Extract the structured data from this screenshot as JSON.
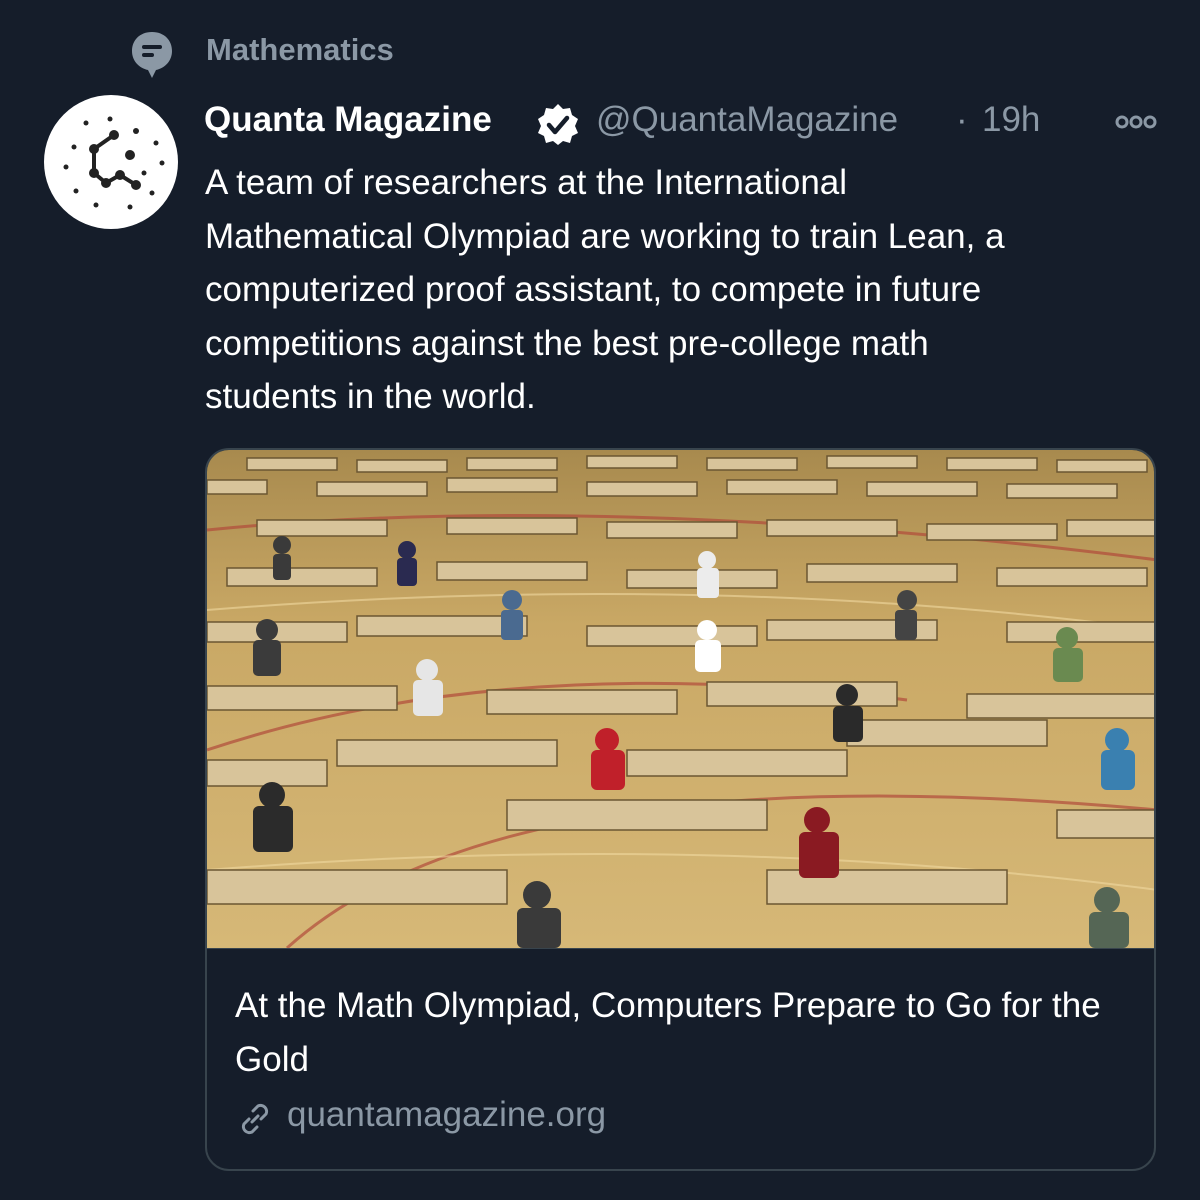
{
  "topic": {
    "label": "Mathematics",
    "icon": "topic-speech-bubble-icon"
  },
  "tweet": {
    "author_name": "Quanta Magazine",
    "verified": true,
    "handle": "@QuantaMagazine",
    "separator": "·",
    "time": "19h",
    "text": "A team of researchers at the International\nMathematical Olympiad are working to train Lean, a\ncomputerized proof assistant, to compete in future\ncompetitions against the best pre-college math\nstudents in the world."
  },
  "card": {
    "title": "At the Math Olympiad, Computers Prepare to Go for the Gold",
    "domain": "quantamagazine.org",
    "image_alt": "Students sitting at rows of exam desks in a large gymnasium"
  },
  "colors": {
    "background": "#151d2a",
    "primary_text": "#ffffff",
    "secondary_text": "#8b98a5",
    "border": "#38444d",
    "gym_floor": "#c9a865"
  },
  "icons": [
    "topic-speech-bubble-icon",
    "verified-badge-icon",
    "more-options-icon",
    "link-icon",
    "quanta-logo-icon"
  ]
}
